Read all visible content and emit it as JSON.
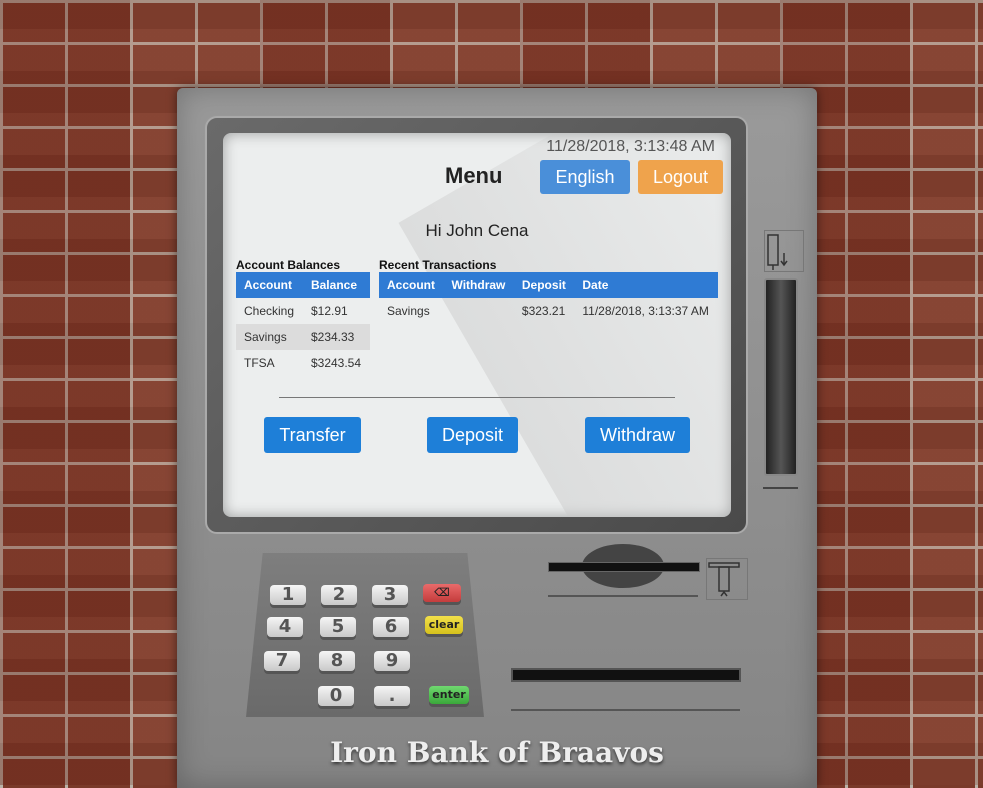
{
  "screen": {
    "datetime": "11/28/2018, 3:13:48 AM",
    "menu_title": "Menu",
    "language_button": "English",
    "logout_button": "Logout",
    "greeting": "Hi John Cena"
  },
  "balances": {
    "title": "Account Balances",
    "headers": [
      "Account",
      "Balance"
    ],
    "rows": [
      {
        "account": "Checking",
        "balance": "$12.91"
      },
      {
        "account": "Savings",
        "balance": "$234.33"
      },
      {
        "account": "TFSA",
        "balance": "$3243.54"
      }
    ]
  },
  "transactions": {
    "title": "Recent Transactions",
    "headers": [
      "Account",
      "Withdraw",
      "Deposit",
      "Date"
    ],
    "rows": [
      {
        "account": "Savings",
        "withdraw": "",
        "deposit": "$323.21",
        "date": "11/28/2018, 3:13:37 AM"
      }
    ]
  },
  "actions": {
    "transfer": "Transfer",
    "deposit": "Deposit",
    "withdraw": "Withdraw"
  },
  "keypad": {
    "keys": [
      "1",
      "2",
      "3",
      "4",
      "5",
      "6",
      "7",
      "8",
      "9",
      "0",
      "."
    ],
    "delete_icon": "⌫",
    "clear": "clear",
    "enter": "enter"
  },
  "brand": "Iron Bank of Braavos",
  "colors": {
    "primary_blue": "#2f7bd4",
    "logout_orange": "#efa34c",
    "clear_yellow": "#f2e04a",
    "enter_green": "#6fd86f",
    "delete_red": "#e96a6a"
  }
}
